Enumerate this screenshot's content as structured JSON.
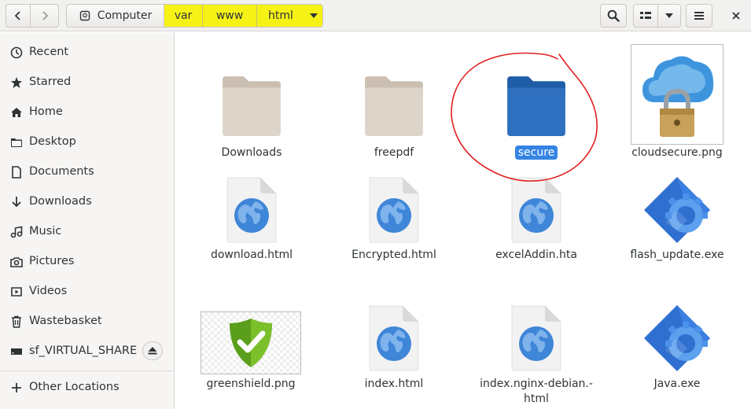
{
  "pathbar": {
    "crumbs": [
      "Computer",
      "var",
      "www",
      "html"
    ]
  },
  "sidebar": {
    "items": [
      {
        "label": "Recent",
        "icon": "clock-icon"
      },
      {
        "label": "Starred",
        "icon": "star-icon"
      },
      {
        "label": "Home",
        "icon": "home-icon"
      },
      {
        "label": "Desktop",
        "icon": "folder-icon"
      },
      {
        "label": "Documents",
        "icon": "document-icon"
      },
      {
        "label": "Downloads",
        "icon": "download-icon"
      },
      {
        "label": "Music",
        "icon": "music-icon"
      },
      {
        "label": "Pictures",
        "icon": "camera-icon"
      },
      {
        "label": "Videos",
        "icon": "video-icon"
      },
      {
        "label": "Wastebasket",
        "icon": "trash-icon"
      },
      {
        "label": "sf_VIRTUAL_SHARE",
        "icon": "drive-icon"
      },
      {
        "label": "Other Locations",
        "icon": "plus-icon"
      }
    ]
  },
  "files": [
    {
      "name": "Downloads",
      "type": "folder"
    },
    {
      "name": "freepdf",
      "type": "folder"
    },
    {
      "name": "secure",
      "type": "folder",
      "selected": true
    },
    {
      "name": "cloudsecure.png",
      "type": "image"
    },
    {
      "name": "download.html",
      "type": "html"
    },
    {
      "name": "Encrypted.html",
      "type": "html"
    },
    {
      "name": "excelAddin.hta",
      "type": "html"
    },
    {
      "name": "flash_update.exe",
      "type": "executable"
    },
    {
      "name": "greenshield.png",
      "type": "image"
    },
    {
      "name": "index.html",
      "type": "html"
    },
    {
      "name": "index.nginx-debian.-",
      "name_line2": "html",
      "type": "html"
    },
    {
      "name": "Java.exe",
      "type": "executable"
    }
  ],
  "colors": {
    "path_highlight": "#f6f216",
    "selection": "#3584e4",
    "annotation": "#e02020"
  }
}
